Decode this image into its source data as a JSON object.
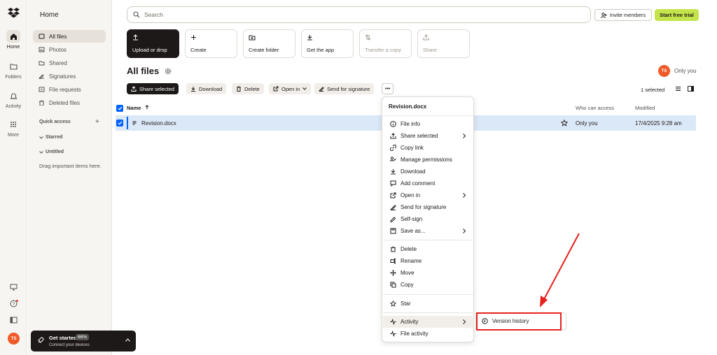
{
  "rail": {
    "items": [
      {
        "label": "Home",
        "icon": "home-icon"
      },
      {
        "label": "Folders",
        "icon": "folder-icon"
      },
      {
        "label": "Activity",
        "icon": "bell-icon"
      },
      {
        "label": "More",
        "icon": "grid-icon"
      }
    ],
    "avatar_initials": "TS"
  },
  "sidebar": {
    "title": "Home",
    "items": [
      {
        "label": "All files"
      },
      {
        "label": "Photos"
      },
      {
        "label": "Shared"
      },
      {
        "label": "Signatures"
      },
      {
        "label": "File requests"
      },
      {
        "label": "Deleted files"
      }
    ],
    "quick_access": "Quick access",
    "starred": "Starred",
    "untitled": "Untitled",
    "drag_hint": "Drag important items here.",
    "get_started": {
      "label": "Get started",
      "progress": "66%",
      "progress_value": 0.66,
      "sub": "Connect your devices"
    }
  },
  "header": {
    "search_placeholder": "Search",
    "invite_label": "Invite members",
    "trial_label": "Start free trial"
  },
  "tiles": [
    {
      "label": "Upload or drop",
      "icon": "upload-icon"
    },
    {
      "label": "Create",
      "icon": "plus-icon"
    },
    {
      "label": "Create folder",
      "icon": "folder-plus-icon"
    },
    {
      "label": "Get the app",
      "icon": "download-icon"
    },
    {
      "label": "Transfer a copy",
      "icon": "transfer-icon"
    },
    {
      "label": "Share",
      "icon": "share-icon"
    }
  ],
  "main": {
    "title": "All files",
    "owner_label": "Only you",
    "owner_initials": "TS",
    "selected_count": "1 selected"
  },
  "toolbar": {
    "share_selected": "Share selected",
    "download": "Download",
    "delete": "Delete",
    "open_in": "Open in",
    "send_for_signature": "Send for signature",
    "more": "•••"
  },
  "table": {
    "headers": {
      "name": "Name",
      "who": "Who can access",
      "modified": "Modified"
    },
    "rows": [
      {
        "name": "Revision.docx",
        "who": "Only you",
        "modified": "17/4/2025 9:28 am"
      }
    ]
  },
  "context_menu": {
    "title": "Revision.docx",
    "items": [
      {
        "label": "File info",
        "icon": "info-icon"
      },
      {
        "label": "Share selected",
        "icon": "share-icon"
      },
      {
        "label": "Copy link",
        "icon": "link-icon"
      },
      {
        "label": "Manage permissions",
        "icon": "permissions-icon"
      },
      {
        "label": "Download",
        "icon": "download-icon"
      },
      {
        "label": "Add comment",
        "icon": "comment-icon"
      },
      {
        "label": "Open in",
        "icon": "open-in-icon"
      },
      {
        "label": "Send for signature",
        "icon": "signature-icon"
      },
      {
        "label": "Self-sign",
        "icon": "self-sign-icon"
      },
      {
        "label": "Save as...",
        "icon": "save-as-icon"
      },
      {
        "label": "Delete",
        "icon": "trash-icon"
      },
      {
        "label": "Rename",
        "icon": "rename-icon"
      },
      {
        "label": "Move",
        "icon": "move-icon"
      },
      {
        "label": "Copy",
        "icon": "copy-icon"
      },
      {
        "label": "Star",
        "icon": "star-icon"
      },
      {
        "label": "Activity",
        "icon": "activity-icon"
      },
      {
        "label": "File activity",
        "icon": "activity-icon"
      }
    ],
    "submenu": {
      "label": "Version history",
      "icon": "clock-icon"
    }
  },
  "colors": {
    "accent": "#0061fe",
    "trial": "#c5e34a",
    "highlight": "#e8201c",
    "avatar": "#f05a28"
  }
}
